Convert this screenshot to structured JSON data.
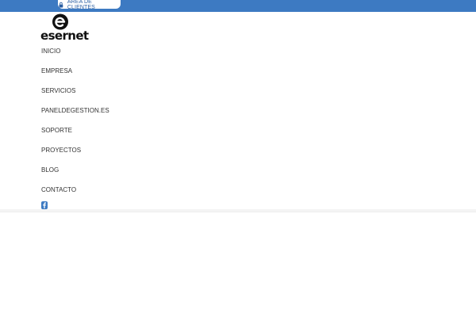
{
  "colors": {
    "accent": "#3d7ac2",
    "social": "#3d7ac2"
  },
  "topbar": {
    "client_area_label": "ÁREA DE CLIENTES",
    "client_area_icon": "lock-icon"
  },
  "brand": {
    "logo_text": "esernet",
    "logo_mark": "E"
  },
  "nav": {
    "items": [
      {
        "label": "INICIO"
      },
      {
        "label": "EMPRESA"
      },
      {
        "label": "SERVICIOS"
      },
      {
        "label": "PANELDEGESTION.ES"
      },
      {
        "label": "SOPORTE"
      },
      {
        "label": "PROYECTOS"
      },
      {
        "label": "BLOG"
      },
      {
        "label": "CONTACTO"
      }
    ]
  },
  "social": {
    "icon": "facebook-icon"
  }
}
